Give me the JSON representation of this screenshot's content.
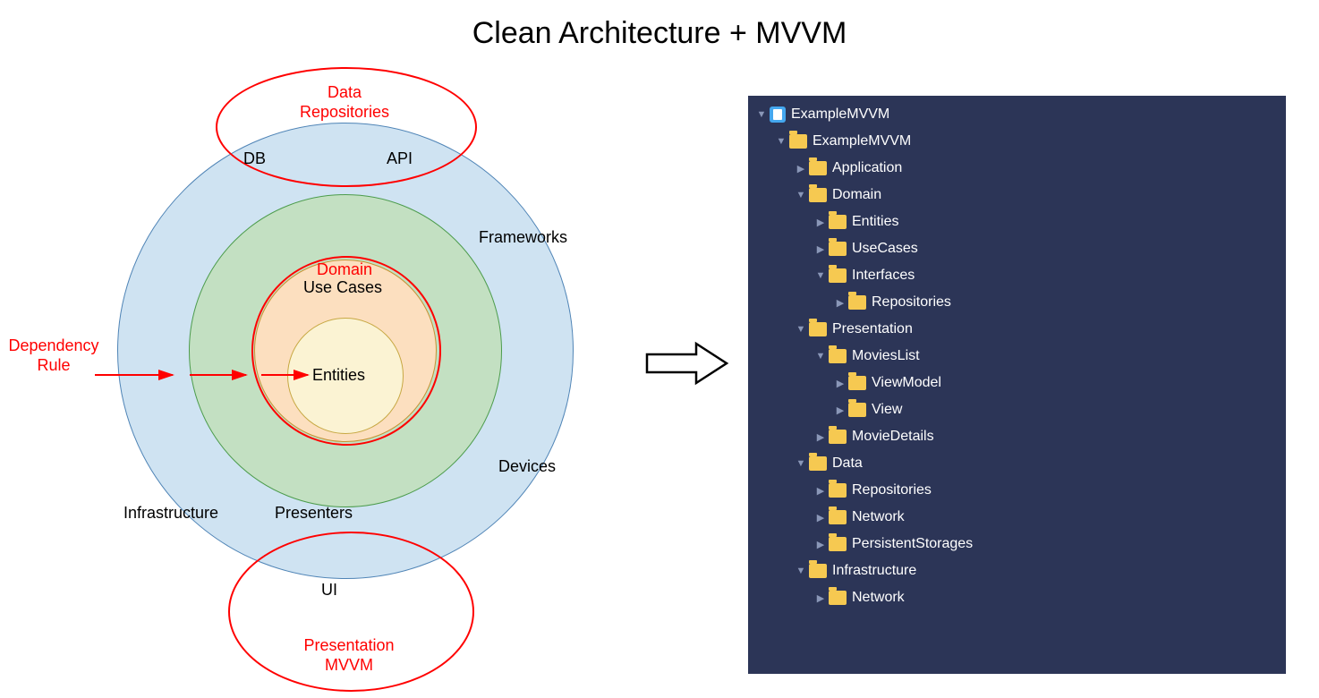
{
  "title": "Clean Architecture + MVVM",
  "diagram": {
    "data_repositories": "Data\nRepositories",
    "domain": "Domain",
    "presentation": "Presentation\nMVVM",
    "dependency_rule": "Dependency\nRule",
    "db": "DB",
    "api": "API",
    "frameworks": "Frameworks",
    "devices": "Devices",
    "infrastructure": "Infrastructure",
    "presenters": "Presenters",
    "use_cases": "Use Cases",
    "entities": "Entities",
    "ui": "UI"
  },
  "tree": [
    {
      "i": 0,
      "d": "down",
      "k": "proj",
      "t": "ExampleMVVM"
    },
    {
      "i": 1,
      "d": "down",
      "k": "fold",
      "t": "ExampleMVVM"
    },
    {
      "i": 2,
      "d": "right",
      "k": "fold",
      "t": "Application"
    },
    {
      "i": 2,
      "d": "down",
      "k": "fold",
      "t": "Domain"
    },
    {
      "i": 3,
      "d": "right",
      "k": "fold",
      "t": "Entities"
    },
    {
      "i": 3,
      "d": "right",
      "k": "fold",
      "t": "UseCases"
    },
    {
      "i": 3,
      "d": "down",
      "k": "fold",
      "t": "Interfaces"
    },
    {
      "i": 4,
      "d": "right",
      "k": "fold",
      "t": "Repositories"
    },
    {
      "i": 2,
      "d": "down",
      "k": "fold",
      "t": "Presentation"
    },
    {
      "i": 3,
      "d": "down",
      "k": "fold",
      "t": "MoviesList"
    },
    {
      "i": 4,
      "d": "right",
      "k": "fold",
      "t": "ViewModel"
    },
    {
      "i": 4,
      "d": "right",
      "k": "fold",
      "t": "View"
    },
    {
      "i": 3,
      "d": "right",
      "k": "fold",
      "t": "MovieDetails"
    },
    {
      "i": 2,
      "d": "down",
      "k": "fold",
      "t": "Data"
    },
    {
      "i": 3,
      "d": "right",
      "k": "fold",
      "t": "Repositories"
    },
    {
      "i": 3,
      "d": "right",
      "k": "fold",
      "t": "Network"
    },
    {
      "i": 3,
      "d": "right",
      "k": "fold",
      "t": "PersistentStorages"
    },
    {
      "i": 2,
      "d": "down",
      "k": "fold",
      "t": "Infrastructure"
    },
    {
      "i": 3,
      "d": "right",
      "k": "fold",
      "t": "Network"
    }
  ]
}
